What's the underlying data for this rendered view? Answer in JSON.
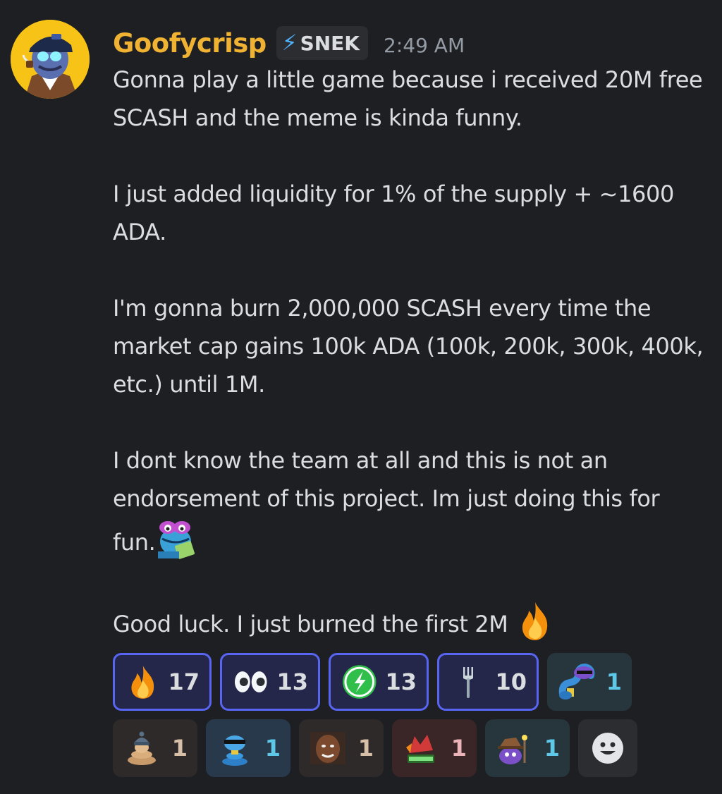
{
  "message": {
    "author": "Goofycrisp",
    "role_tag": "SNEK",
    "role_icon": "lightning-icon",
    "timestamp": "2:49 AM",
    "avatar_icon": "cartoon-avatar",
    "lines": [
      "Gonna play a little game because i received 20M free",
      "SCASH and the meme is kinda funny.",
      "I just added liquidity for 1% of the supply + ~1600",
      "ADA.",
      "I'm gonna burn 2,000,000 SCASH every time the",
      "market cap gains 100k ADA (100k, 200k, 300k, 400k,",
      "etc.) until 1M.",
      "I dont know the team at all and this is not an",
      "endorsement of this project. Im just doing this for",
      "fun.",
      "Good luck. I just burned the first 2M"
    ],
    "inline_emojis": [
      "frog-reading-emoji",
      "fire-emoji"
    ]
  },
  "reactions": [
    {
      "emoji": "fire-emoji",
      "count": "17"
    },
    {
      "emoji": "eyes-emoji",
      "count": "13"
    },
    {
      "emoji": "green-snek-emoji",
      "count": "13"
    },
    {
      "emoji": "fork-emoji",
      "count": "10"
    },
    {
      "emoji": "cool-snake-emoji",
      "count": "1"
    },
    {
      "emoji": "beanie-snake-emoji",
      "count": "1"
    },
    {
      "emoji": "sunglasses-snake-emoji",
      "count": "1"
    },
    {
      "emoji": "man-face-emoji",
      "count": "1"
    },
    {
      "emoji": "hype-dragon-emoji",
      "count": "1"
    },
    {
      "emoji": "wizard-blob-emoji",
      "count": "1"
    }
  ],
  "add_reaction_icon": "add-reaction-smiley-icon",
  "colors": {
    "background": "#1e1f22",
    "username": "#f0b232",
    "role_bolt": "#4fb3ff",
    "timestamp": "#949ba4",
    "reaction_selected_border": "#5865f2"
  }
}
